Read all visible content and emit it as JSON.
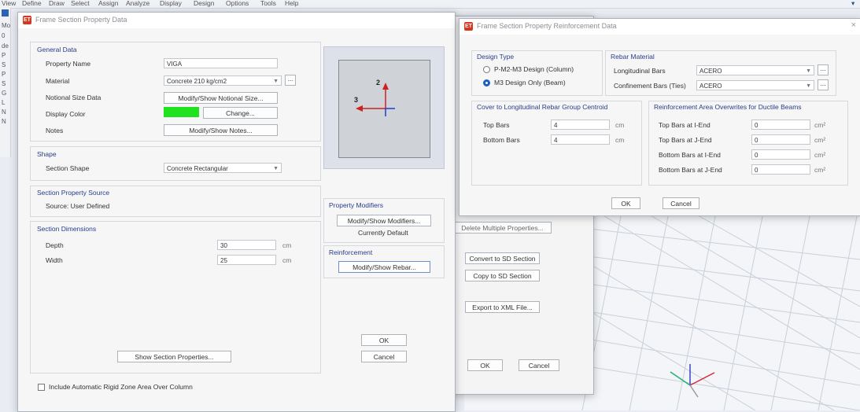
{
  "menubar": {
    "items": [
      "View",
      "Define",
      "Draw",
      "Select",
      "Assign",
      "Analyze",
      "Display",
      "Design",
      "Options",
      "Tools",
      "Help"
    ]
  },
  "leftstrip": {
    "items": [
      "Mo",
      "0",
      "de",
      "P",
      "S",
      "P",
      "S",
      "G",
      "L",
      "N",
      "N"
    ]
  },
  "frame_dialog": {
    "title": "Frame Section Property Data",
    "general": {
      "label": "General Data",
      "property_name_label": "Property Name",
      "property_name_value": "VIGA",
      "material_label": "Material",
      "material_value": "Concrete 210 kg/cm2",
      "notional_label": "Notional Size Data",
      "notional_button": "Modify/Show Notional Size...",
      "display_color_label": "Display Color",
      "display_color": "#21e21e",
      "change_button": "Change...",
      "notes_label": "Notes",
      "notes_button": "Modify/Show Notes..."
    },
    "shape": {
      "label": "Shape",
      "section_shape_label": "Section Shape",
      "section_shape_value": "Concrete Rectangular"
    },
    "source": {
      "label": "Section Property Source",
      "source_text": "Source:  User Defined"
    },
    "dimensions": {
      "label": "Section Dimensions",
      "depth_label": "Depth",
      "depth_value": "30",
      "depth_unit": "cm",
      "width_label": "Width",
      "width_value": "25",
      "width_unit": "cm"
    },
    "preview": {
      "axis_2": "2",
      "axis_3": "3"
    },
    "modifiers": {
      "label": "Property Modifiers",
      "button": "Modify/Show Modifiers...",
      "status": "Currently Default"
    },
    "reinforcement": {
      "label": "Reinforcement",
      "button": "Modify/Show Rebar..."
    },
    "show_props_button": "Show Section Properties...",
    "ok_button": "OK",
    "cancel_button": "Cancel",
    "rigid_zone_label": "Include Automatic Rigid Zone Area Over Column"
  },
  "behind_dialog": {
    "partial_button": "Delete Multiple Properties...",
    "convert_button": "Convert to SD Section",
    "copy_button": "Copy to SD Section",
    "export_button": "Export to XML File...",
    "ok_button": "OK",
    "cancel_button": "Cancel"
  },
  "rebar_dialog": {
    "title": "Frame Section Property Reinforcement Data",
    "design_type": {
      "label": "Design Type",
      "option_column": "P-M2-M3 Design  (Column)",
      "option_beam": "M3 Design Only  (Beam)",
      "selected": "beam"
    },
    "rebar_material": {
      "label": "Rebar Material",
      "long_label": "Longitudinal Bars",
      "long_value": "ACERO",
      "conf_label": "Confinement Bars (Ties)",
      "conf_value": "ACERO"
    },
    "cover": {
      "label": "Cover to Longitudinal Rebar Group Centroid",
      "top_label": "Top Bars",
      "top_value": "4",
      "top_unit": "cm",
      "bottom_label": "Bottom  Bars",
      "bottom_value": "4",
      "bottom_unit": "cm"
    },
    "overwrites": {
      "label": "Reinforcement Area Overwrites for Ductile Beams",
      "rows": [
        {
          "label": "Top Bars at I-End",
          "value": "0",
          "unit": "cm²"
        },
        {
          "label": "Top Bars at J-End",
          "value": "0",
          "unit": "cm²"
        },
        {
          "label": "Bottom Bars at I-End",
          "value": "0",
          "unit": "cm²"
        },
        {
          "label": "Bottom Bars at J-End",
          "value": "0",
          "unit": "cm²"
        }
      ]
    },
    "ok_button": "OK",
    "cancel_button": "Cancel"
  }
}
